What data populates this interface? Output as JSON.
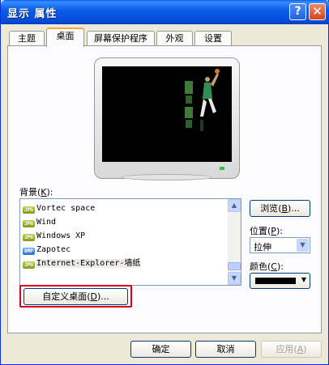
{
  "window": {
    "title": "显示 属性",
    "help": "?",
    "close": "✕"
  },
  "tabs": [
    {
      "label": "主题"
    },
    {
      "label": "桌面"
    },
    {
      "label": "屏幕保护程序"
    },
    {
      "label": "外观"
    },
    {
      "label": "设置"
    }
  ],
  "desktop": {
    "background_label": "背景",
    "background_key": "K",
    "items": [
      {
        "name": "Vortec space",
        "type": "JPG"
      },
      {
        "name": "Wind",
        "type": "JPG"
      },
      {
        "name": "Windows XP",
        "type": "JPG"
      },
      {
        "name": "Zapotec",
        "type": "BMP"
      },
      {
        "name": "Internet-Explorer-墙纸",
        "type": "JPG"
      }
    ],
    "browse_label": "浏览",
    "browse_key": "B",
    "position_label": "位置",
    "position_key": "P",
    "position_value": "拉伸",
    "color_label": "颜色",
    "color_key": "C",
    "color_value": "#000000",
    "customize_label": "自定义桌面",
    "customize_key": "D"
  },
  "buttons": {
    "ok": "确定",
    "cancel": "取消",
    "apply": "应用",
    "apply_key": "A"
  }
}
